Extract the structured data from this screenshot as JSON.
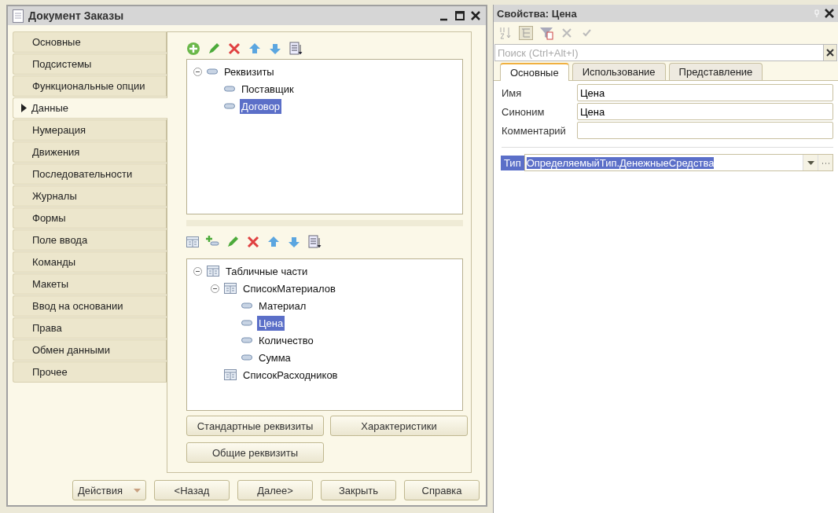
{
  "window": {
    "title": "Документ Заказы"
  },
  "nav": [
    {
      "label": "Основные",
      "selected": false
    },
    {
      "label": "Подсистемы",
      "selected": false
    },
    {
      "label": "Функциональные опции",
      "selected": false
    },
    {
      "label": "Данные",
      "selected": true
    },
    {
      "label": "Нумерация",
      "selected": false
    },
    {
      "label": "Движения",
      "selected": false
    },
    {
      "label": "Последовательности",
      "selected": false
    },
    {
      "label": "Журналы",
      "selected": false
    },
    {
      "label": "Формы",
      "selected": false
    },
    {
      "label": "Поле ввода",
      "selected": false
    },
    {
      "label": "Команды",
      "selected": false
    },
    {
      "label": "Макеты",
      "selected": false
    },
    {
      "label": "Ввод на основании",
      "selected": false
    },
    {
      "label": "Права",
      "selected": false
    },
    {
      "label": "Обмен данными",
      "selected": false
    },
    {
      "label": "Прочее",
      "selected": false
    }
  ],
  "attributes_tree": [
    {
      "label": "Реквизиты",
      "kind": "attribute",
      "expanded": true,
      "selected": false,
      "children": [
        {
          "label": "Поставщик",
          "kind": "attribute",
          "selected": false
        },
        {
          "label": "Договор",
          "kind": "attribute",
          "selected": true
        }
      ]
    }
  ],
  "tabular_tree": [
    {
      "label": "Табличные части",
      "kind": "table",
      "expanded": true,
      "selected": false,
      "children": [
        {
          "label": "СписокМатериалов",
          "kind": "table",
          "expanded": true,
          "selected": false,
          "children": [
            {
              "label": "Материал",
              "kind": "attribute",
              "selected": false
            },
            {
              "label": "Цена",
              "kind": "attribute",
              "selected": true
            },
            {
              "label": "Количество",
              "kind": "attribute",
              "selected": false
            },
            {
              "label": "Сумма",
              "kind": "attribute",
              "selected": false
            }
          ]
        },
        {
          "label": "СписокРасходников",
          "kind": "table",
          "selected": false
        }
      ]
    }
  ],
  "panel_buttons": [
    "Стандартные реквизиты",
    "Характеристики",
    "Общие реквизиты"
  ],
  "footer": {
    "actions": "Действия",
    "buttons": [
      "<Назад",
      "Далее>",
      "Закрыть",
      "Справка"
    ]
  },
  "properties": {
    "title": "Свойства: Цена",
    "search": {
      "placeholder": "Поиск (Ctrl+Alt+I)"
    },
    "tabs": [
      {
        "label": "Основные",
        "selected": true
      },
      {
        "label": "Использование",
        "selected": false
      },
      {
        "label": "Представление",
        "selected": false
      }
    ],
    "fields": [
      {
        "label": "Имя",
        "value": "Цена"
      },
      {
        "label": "Синоним",
        "value": "Цена"
      },
      {
        "label": "Комментарий"
      }
    ],
    "type": {
      "label": "Тип",
      "value": "ОпределяемыйТип.ДенежныеСредства"
    }
  }
}
